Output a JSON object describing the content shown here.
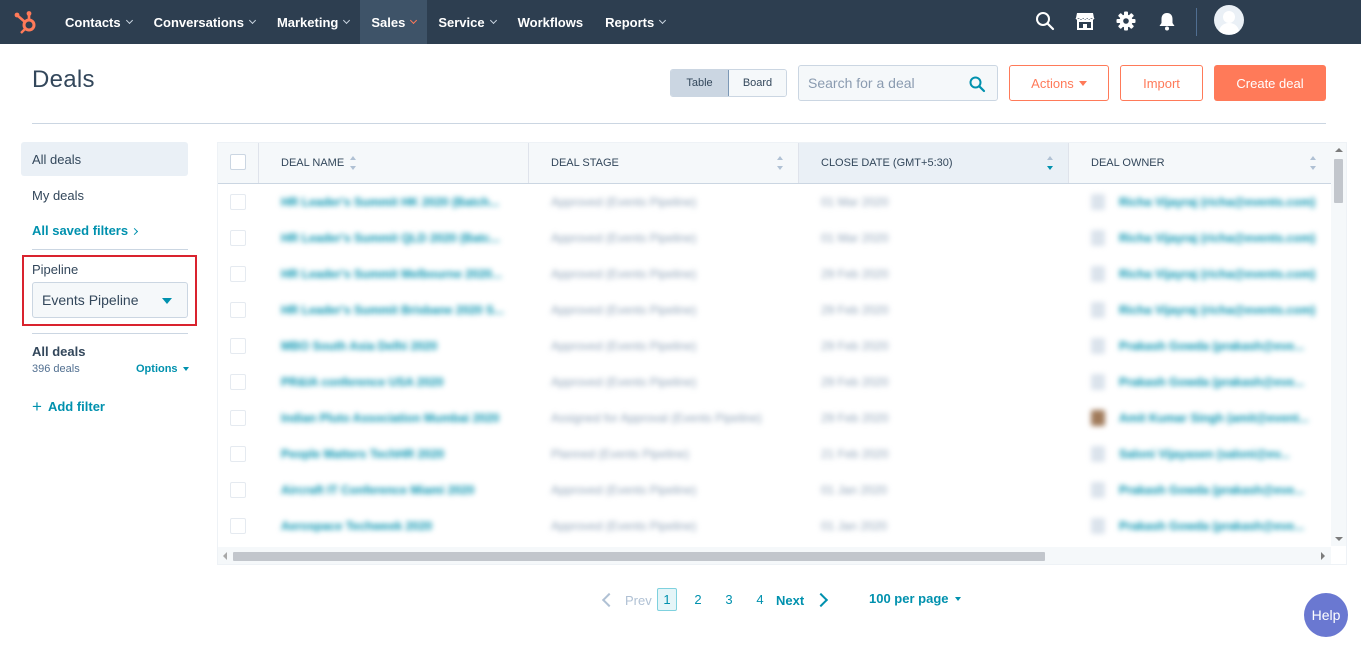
{
  "nav": {
    "items": [
      {
        "label": "Contacts",
        "dropdown": true
      },
      {
        "label": "Conversations",
        "dropdown": true
      },
      {
        "label": "Marketing",
        "dropdown": true
      },
      {
        "label": "Sales",
        "dropdown": true,
        "active": true
      },
      {
        "label": "Service",
        "dropdown": true
      },
      {
        "label": "Workflows",
        "dropdown": false
      },
      {
        "label": "Reports",
        "dropdown": true
      }
    ],
    "icons": [
      "search-icon",
      "marketplace-icon",
      "settings-gear-icon",
      "notifications-bell-icon"
    ],
    "brand_color": "#ff7a59",
    "bar_color": "#2d3e50"
  },
  "header": {
    "title": "Deals",
    "view_toggle": {
      "table": "Table",
      "board": "Board",
      "selected": "Table"
    },
    "search_placeholder": "Search for a deal",
    "actions_label": "Actions",
    "import_label": "Import",
    "create_label": "Create deal"
  },
  "sidebar": {
    "all_deals": "All deals",
    "my_deals": "My deals",
    "saved_filters": "All saved filters",
    "pipeline_label": "Pipeline",
    "pipeline_value": "Events Pipeline",
    "view_name": "All deals",
    "view_count": "396 deals",
    "options_label": "Options",
    "add_filter_label": "Add filter"
  },
  "table": {
    "columns": {
      "name": "Deal Name",
      "stage": "Deal Stage",
      "close_date": "Close Date (GMT+5:30)",
      "owner": "Deal Owner"
    },
    "rows": [
      {
        "name": "HR Leader's Summit HK 2020 (Batch...",
        "stage": "Approved (Events Pipeline)",
        "date": "01 Mar 2020",
        "owner": "Richa Vijayraj (richa@events.com)",
        "photo": false
      },
      {
        "name": "HR Leader's Summit QLD 2020 (Batc...",
        "stage": "Approved (Events Pipeline)",
        "date": "01 Mar 2020",
        "owner": "Richa Vijayraj (richa@events.com)",
        "photo": false
      },
      {
        "name": "HR Leader's Summit Melbourne 2020...",
        "stage": "Approved (Events Pipeline)",
        "date": "29 Feb 2020",
        "owner": "Richa Vijayraj (richa@events.com)",
        "photo": false
      },
      {
        "name": "HR Leader's Summit Brisbane 2020 S...",
        "stage": "Approved (Events Pipeline)",
        "date": "29 Feb 2020",
        "owner": "Richa Vijayraj (richa@events.com)",
        "photo": false
      },
      {
        "name": "MBO South Asia Delhi 2020",
        "stage": "Approved (Events Pipeline)",
        "date": "29 Feb 2020",
        "owner": "Prakash Gowda (prakash@eve...",
        "photo": false
      },
      {
        "name": "PR&IA conference USA 2020",
        "stage": "Approved (Events Pipeline)",
        "date": "29 Feb 2020",
        "owner": "Prakash Gowda (prakash@eve...",
        "photo": false
      },
      {
        "name": "Indian Pluto Association Mumbai 2020",
        "stage": "Assigned for Approval (Events Pipeline)",
        "date": "29 Feb 2020",
        "owner": "Amit Kumar Singh (amit@event...",
        "photo": true
      },
      {
        "name": "People Matters TechHR 2020",
        "stage": "Planned (Events Pipeline)",
        "date": "21 Feb 2020",
        "owner": "Saloni Vijayasen (saloni@ev...",
        "photo": false
      },
      {
        "name": "Aircraft IT Conference Miami 2020",
        "stage": "Approved (Events Pipeline)",
        "date": "01 Jan 2020",
        "owner": "Prakash Gowda (prakash@eve...",
        "photo": false
      },
      {
        "name": "Aerospace Techweek 2020",
        "stage": "Approved (Events Pipeline)",
        "date": "01 Jan 2020",
        "owner": "Prakash Gowda (prakash@eve...",
        "photo": false
      }
    ]
  },
  "pagination": {
    "prev": "Prev",
    "pages": [
      "1",
      "2",
      "3",
      "4"
    ],
    "current": "1",
    "next": "Next",
    "per_page": "100 per page"
  },
  "help_label": "Help",
  "colors": {
    "accent": "#0091ae",
    "primary_button": "#ff7a59",
    "highlight_box": "#d9232e",
    "help_button": "#6a78d1"
  }
}
